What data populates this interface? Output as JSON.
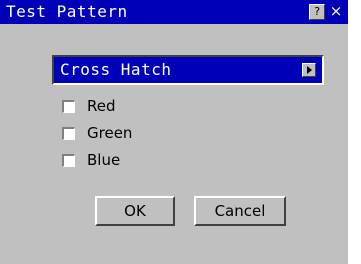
{
  "window": {
    "title": "Test Pattern",
    "help_glyph": "?",
    "close_glyph": "×"
  },
  "pattern_select": {
    "value": "Cross Hatch"
  },
  "checkboxes": [
    {
      "label": "Red",
      "checked": false
    },
    {
      "label": "Green",
      "checked": false
    },
    {
      "label": "Blue",
      "checked": false
    }
  ],
  "buttons": {
    "ok": "OK",
    "cancel": "Cancel"
  },
  "colors": {
    "titlebar": "#0000b8",
    "dialog_bg": "#c0c0c0"
  }
}
